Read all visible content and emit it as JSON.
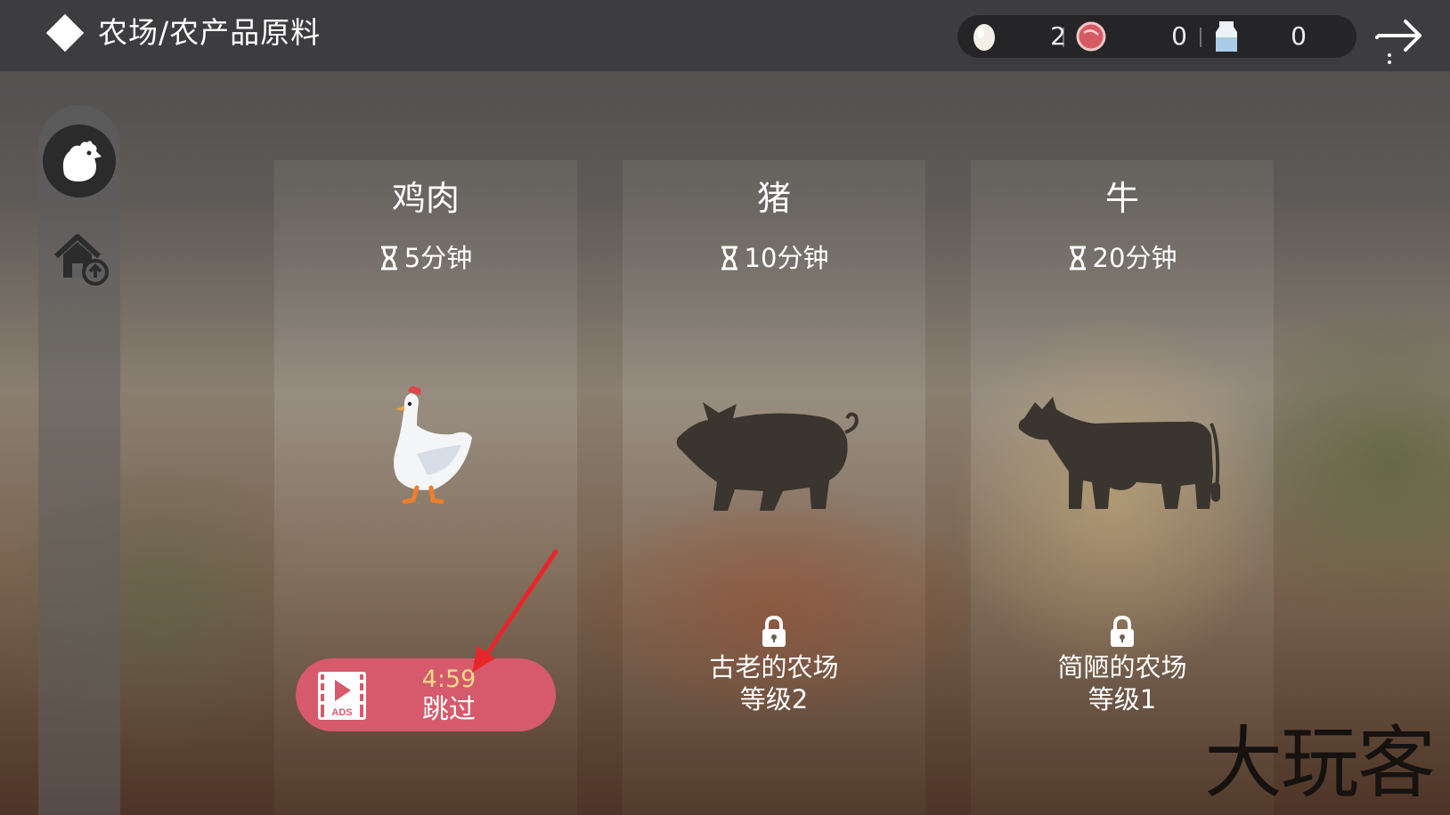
{
  "header": {
    "title": "农场/农产品原料",
    "resources": [
      {
        "icon": "egg-icon",
        "value": "2"
      },
      {
        "icon": "meat-icon",
        "value": "0"
      },
      {
        "icon": "milk-icon",
        "value": "0"
      }
    ]
  },
  "sidebar": {
    "items": [
      {
        "icon": "chicken-icon",
        "active": true
      },
      {
        "icon": "home-upgrade-icon",
        "active": false
      }
    ]
  },
  "animals": [
    {
      "name": "鸡肉",
      "timer": "5分钟",
      "status": "unlocked"
    },
    {
      "name": "猪",
      "timer": "10分钟",
      "status": "locked",
      "lock_line1": "古老的农场",
      "lock_line2": "等级2"
    },
    {
      "name": "牛",
      "timer": "20分钟",
      "status": "locked",
      "lock_line1": "简陋的农场",
      "lock_line2": "等级1"
    }
  ],
  "ad_button": {
    "time": "4:59",
    "label": "跳过",
    "icon_text": "ADS"
  },
  "watermark": "大玩客",
  "colors": {
    "ad_button": "#d65a6c",
    "ad_time": "#f7d98b",
    "annotation_arrow": "#e8262a"
  }
}
